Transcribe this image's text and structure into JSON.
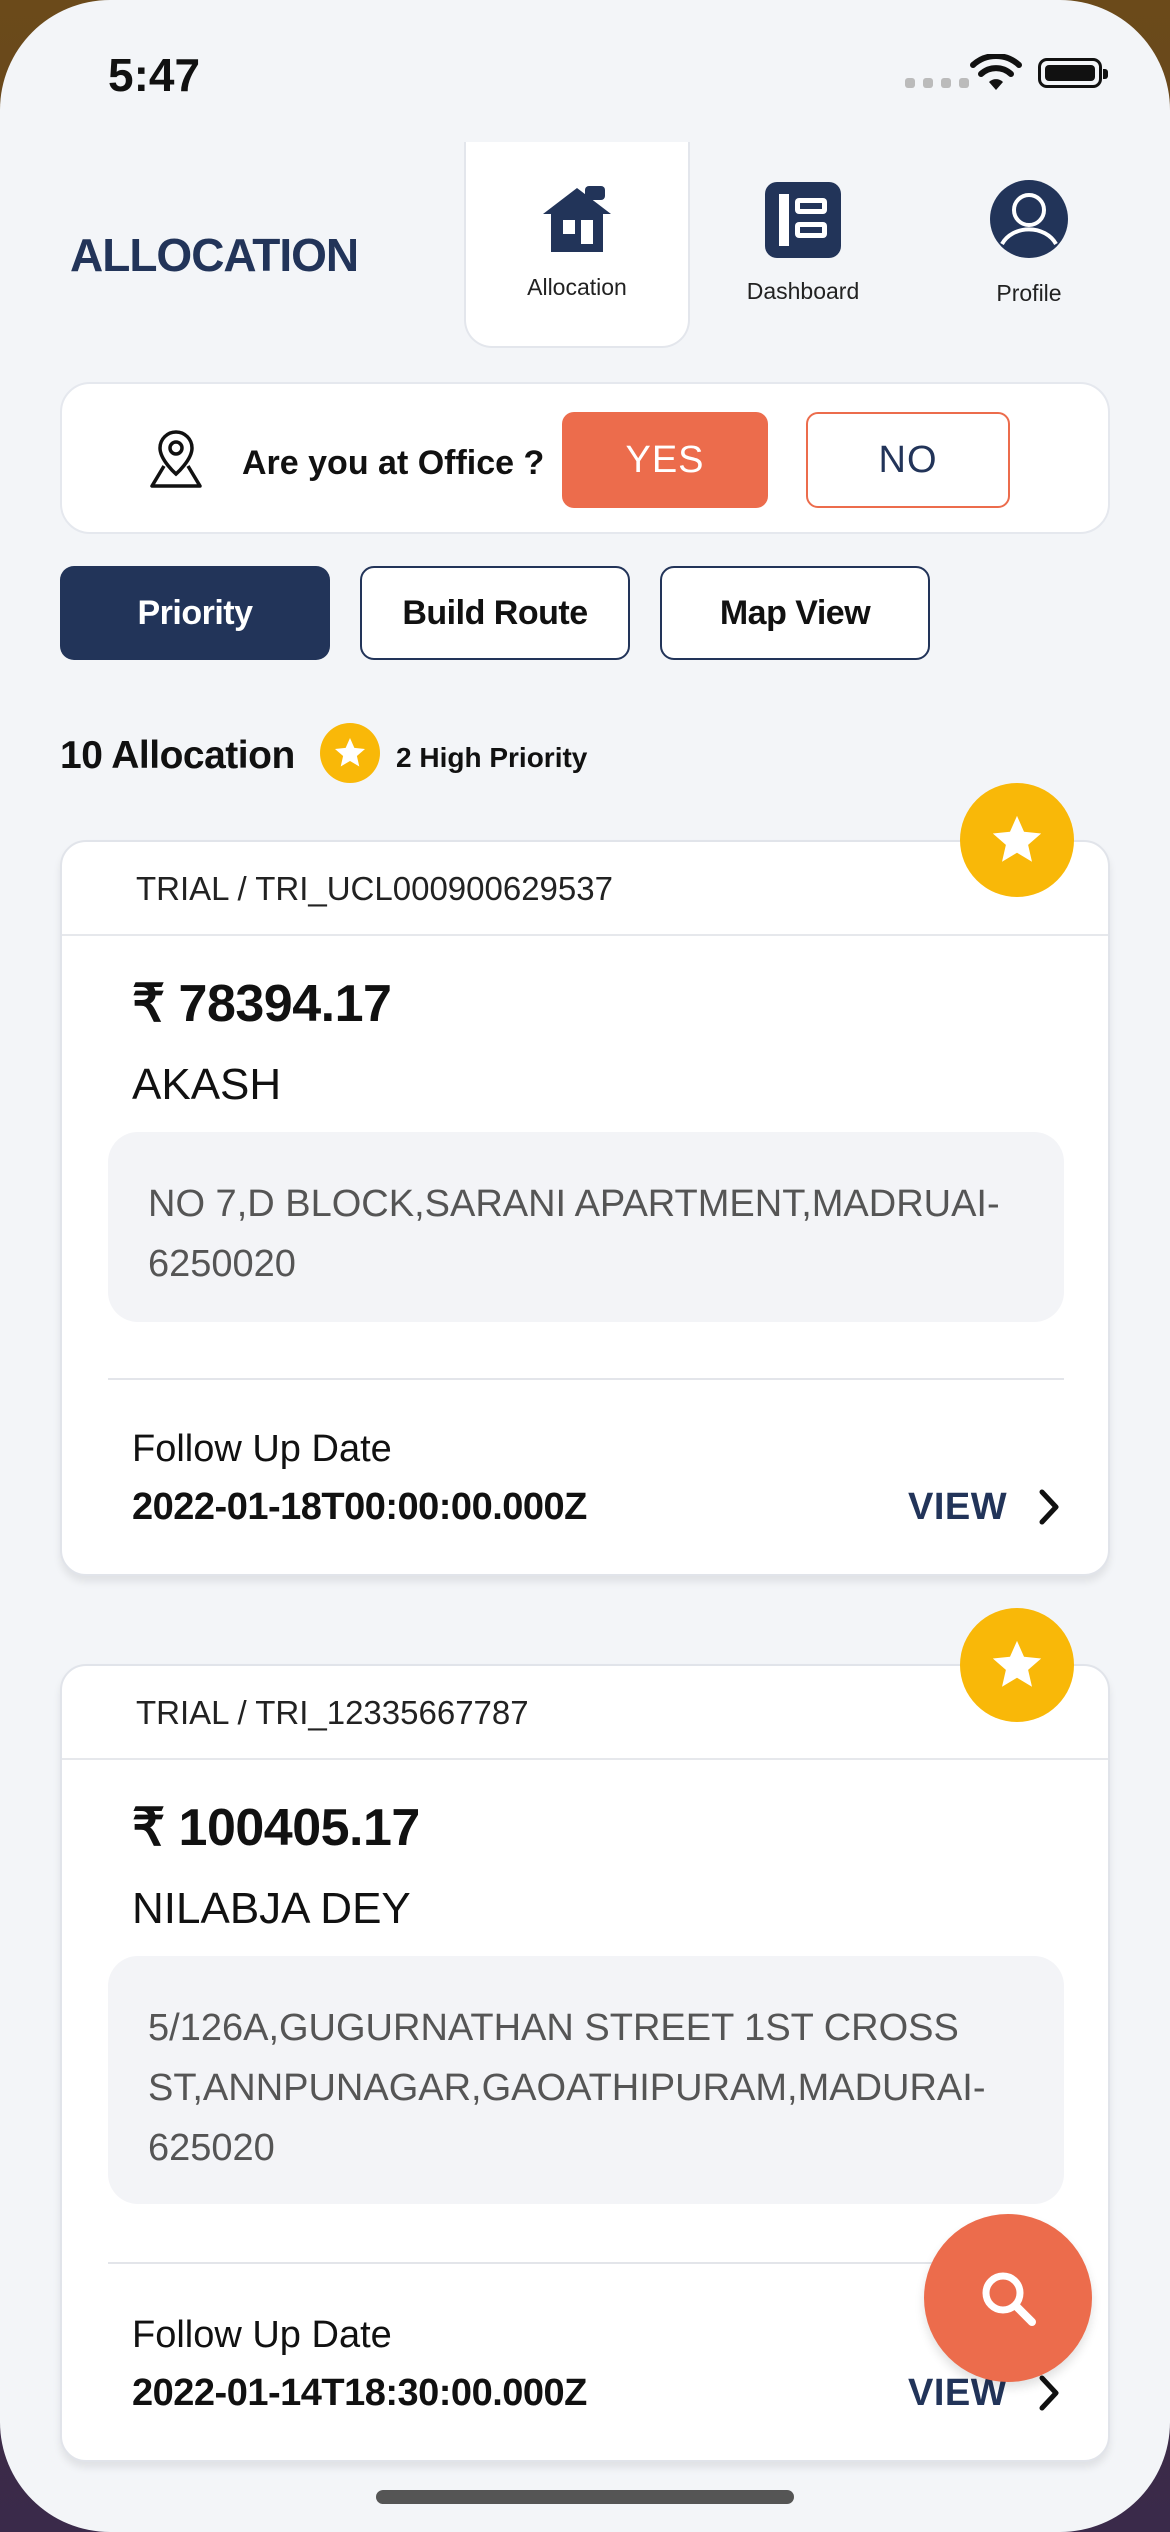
{
  "status": {
    "time": "5:47"
  },
  "header": {
    "title": "ALLOCATION"
  },
  "nav": {
    "allocation": "Allocation",
    "dashboard": "Dashboard",
    "profile": "Profile"
  },
  "office": {
    "question": "Are you at Office ?",
    "yes": "YES",
    "no": "NO"
  },
  "tabs": {
    "priority": "Priority",
    "build_route": "Build Route",
    "map_view": "Map View"
  },
  "summary": {
    "count": "10 Allocation",
    "high_priority": "2 High Priority"
  },
  "cards": [
    {
      "ref": "TRIAL / TRI_UCL000900629537",
      "amount": "₹ 78394.17",
      "name": "AKASH",
      "address": "NO 7,D BLOCK,SARANI APARTMENT,MADRUAI-6250020",
      "follow_up_label": "Follow Up Date",
      "follow_up_date": "2022-01-18T00:00:00.000Z",
      "view": "VIEW"
    },
    {
      "ref": "TRIAL / TRI_12335667787",
      "amount": "₹ 100405.17",
      "name": "NILABJA DEY",
      "address": "5/126A,GUGURNATHAN STREET 1ST CROSS ST,ANNPUNAGAR,GAOATHIPURAM,MADURAI-625020",
      "follow_up_label": "Follow Up Date",
      "follow_up_date": "2022-01-14T18:30:00.000Z",
      "view": "VIEW"
    }
  ],
  "colors": {
    "navy": "#223459",
    "accent": "#ec6c4c",
    "star": "#f9b808"
  },
  "icons": [
    "home-icon",
    "dashboard-icon",
    "profile-icon",
    "location-pin-icon",
    "star-icon",
    "chevron-right-icon",
    "search-icon",
    "wifi-icon",
    "battery-icon"
  ]
}
